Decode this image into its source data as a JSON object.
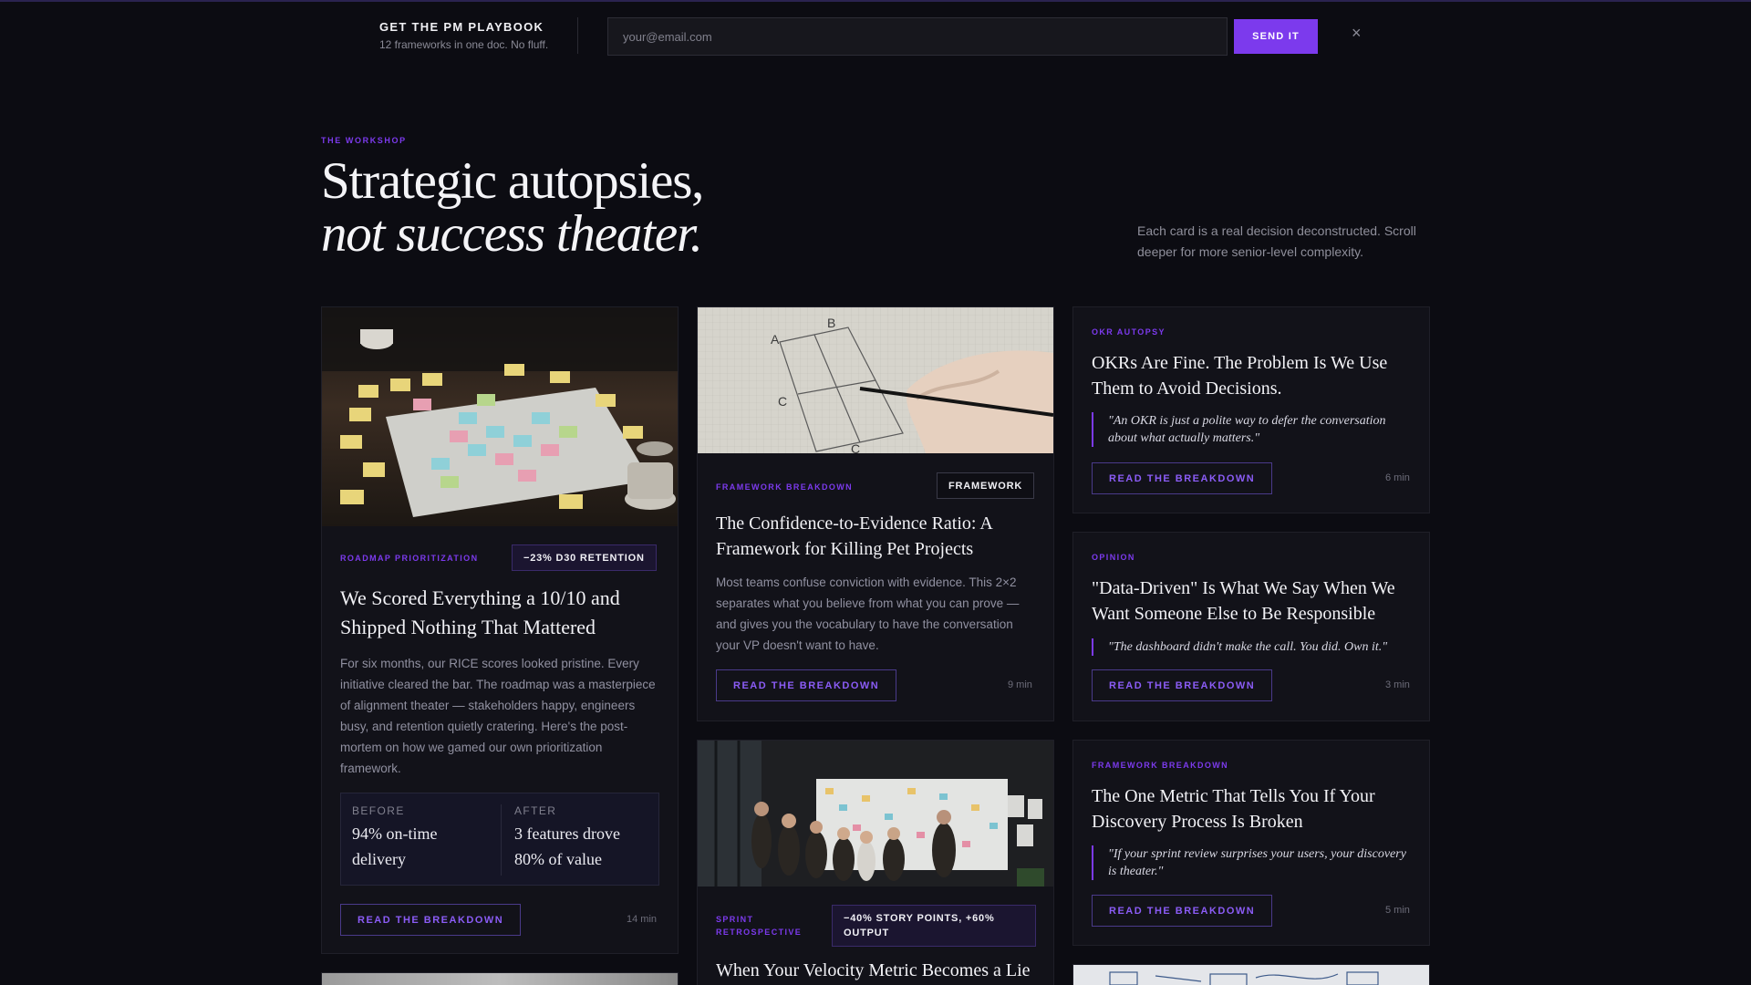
{
  "signup": {
    "title": "GET THE PM PLAYBOOK",
    "subtitle": "12 frameworks in one doc. No fluff.",
    "email_placeholder": "your@email.com",
    "send_label": "SEND IT",
    "close_glyph": "×"
  },
  "hero": {
    "eyebrow": "THE WORKSHOP",
    "title_line1": "Strategic autopsies,",
    "title_line2": "not success theater.",
    "description": "Each card is a real decision deconstructed. Scroll deeper for more senior-level complexity."
  },
  "cards": {
    "roadmap": {
      "tag": "ROADMAP PRIORITIZATION",
      "pill": "−23% D30 RETENTION",
      "title": "We Scored Everything a 10/10 and Shipped Nothing That Mattered",
      "body": "For six months, our RICE scores looked pristine. Every initiative cleared the bar. The roadmap was a masterpiece of alignment theater — stakeholders happy, engineers busy, and retention quietly cratering. Here's the post-mortem on how we gamed our own prioritization framework.",
      "before_label": "BEFORE",
      "before_value": "94% on-time delivery",
      "after_label": "AFTER",
      "after_value": "3 features drove 80% of value",
      "cta": "READ THE BREAKDOWN",
      "minutes": "14 min"
    },
    "confidence": {
      "tag": "FRAMEWORK BREAKDOWN",
      "pill": "FRAMEWORK",
      "title": "The Confidence-to-Evidence Ratio: A Framework for Killing Pet Projects",
      "body": "Most teams confuse conviction with evidence. This 2×2 separates what you believe from what you can prove — and gives you the vocabulary to have the conversation your VP doesn't want to have.",
      "cta": "READ THE BREAKDOWN",
      "minutes": "9 min"
    },
    "sprint": {
      "tag": "SPRINT RETROSPECTIVE",
      "pill": "−40% STORY POINTS, +60% OUTPUT",
      "title": "When Your Velocity Metric Becomes a Lie"
    },
    "okr": {
      "tag": "OKR AUTOPSY",
      "title": "OKRs Are Fine. The Problem Is We Use Them to Avoid Decisions.",
      "quote": "\"An OKR is just a polite way to defer the conversation about what actually matters.\"",
      "cta": "READ THE BREAKDOWN",
      "minutes": "6 min"
    },
    "opinion": {
      "tag": "OPINION",
      "title": "\"Data-Driven\" Is What We Say When We Want Someone Else to Be Responsible",
      "quote": "\"The dashboard didn't make the call. You did. Own it.\"",
      "cta": "READ THE BREAKDOWN",
      "minutes": "3 min"
    },
    "metric": {
      "tag": "FRAMEWORK BREAKDOWN",
      "title": "The One Metric That Tells You If Your Discovery Process Is Broken",
      "quote": "\"If your sprint review surprises your users, your discovery is theater.\"",
      "cta": "READ THE BREAKDOWN",
      "minutes": "5 min"
    }
  },
  "sketch_letters": {
    "a": "A",
    "b": "B",
    "c": "C",
    "d": "C"
  },
  "colors": {
    "accent": "#7c3aed",
    "background": "#0c0c12",
    "card": "#121219"
  },
  "icons": {
    "close": "close-icon"
  }
}
